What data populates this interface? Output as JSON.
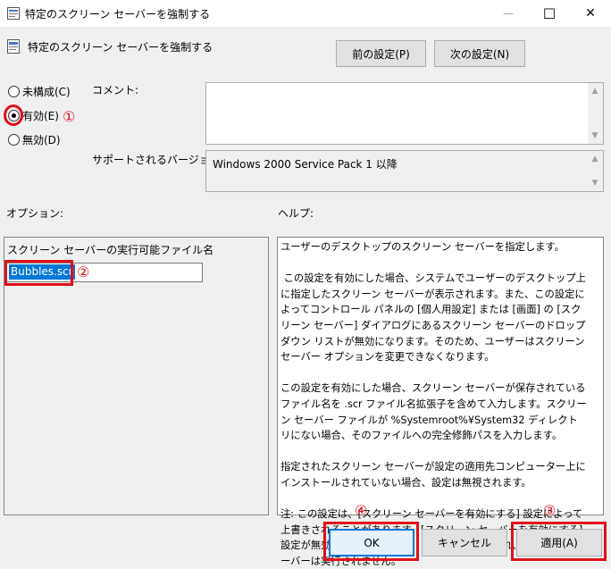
{
  "window": {
    "title": "特定のスクリーン セーバーを強制する",
    "min_glyph": "—",
    "max_glyph": "☐",
    "close_glyph": "✕"
  },
  "header": {
    "policy_title": "特定のスクリーン セーバーを強制する",
    "prev_button": "前の設定(P)",
    "next_button": "次の設定(N)"
  },
  "state": {
    "options": [
      {
        "label": "未構成(C)",
        "checked": false
      },
      {
        "label": "有効(E)",
        "checked": true
      },
      {
        "label": "無効(D)",
        "checked": false
      }
    ]
  },
  "comment": {
    "label": "コメント:",
    "value": ""
  },
  "supported": {
    "label": "サポートされるバージョン:",
    "value": "Windows 2000 Service Pack 1 以降"
  },
  "options_section": {
    "label": "オプション:",
    "exe_label": "スクリーン セーバーの実行可能ファイル名",
    "exe_value": "Bubbles.scr"
  },
  "help_section": {
    "label": "ヘルプ:",
    "text": "ユーザーのデスクトップのスクリーン セーバーを指定します。\n\n この設定を有効にした場合、システムでユーザーのデスクトップ上に指定したスクリーン セーバーが表示されます。また、この設定によってコントロール パネルの [個人用設定] または [画面] の [スクリーン セーバー] ダイアログにあるスクリーン セーバーのドロップダウン リストが無効になります。そのため、ユーザーはスクリーン セーバー オプションを変更できなくなります。\n\nこの設定を有効にした場合、スクリーン セーバーが保存されているファイル名を .scr ファイル名拡張子を含めて入力します。スクリーン セーバー ファイルが %Systemroot%¥System32 ディレクトリにない場合、そのファイルへの完全修飾パスを入力します。\n\n指定されたスクリーン セーバーが設定の適用先コンピューター上にインストールされていない場合、設定は無視されます。\n\n注: この設定は、[スクリーン セーバーを有効にする] 設定によって上書きされることがあります。[スクリーン セーバーを有効にする] 設定が無効になっている場合、この設定は無視され、スクリーン セーバーは実行されません。"
  },
  "footer": {
    "ok": "OK",
    "cancel": "キャンセル",
    "apply": "適用(A)"
  },
  "annotations": {
    "step1": "①",
    "step2": "②",
    "step3": "③",
    "step4": "④",
    "color": "#e0101a"
  },
  "colors": {
    "accent": "#0078d7",
    "annotation_red": "#e0101a",
    "dialog_bg": "#f0f0f0"
  }
}
